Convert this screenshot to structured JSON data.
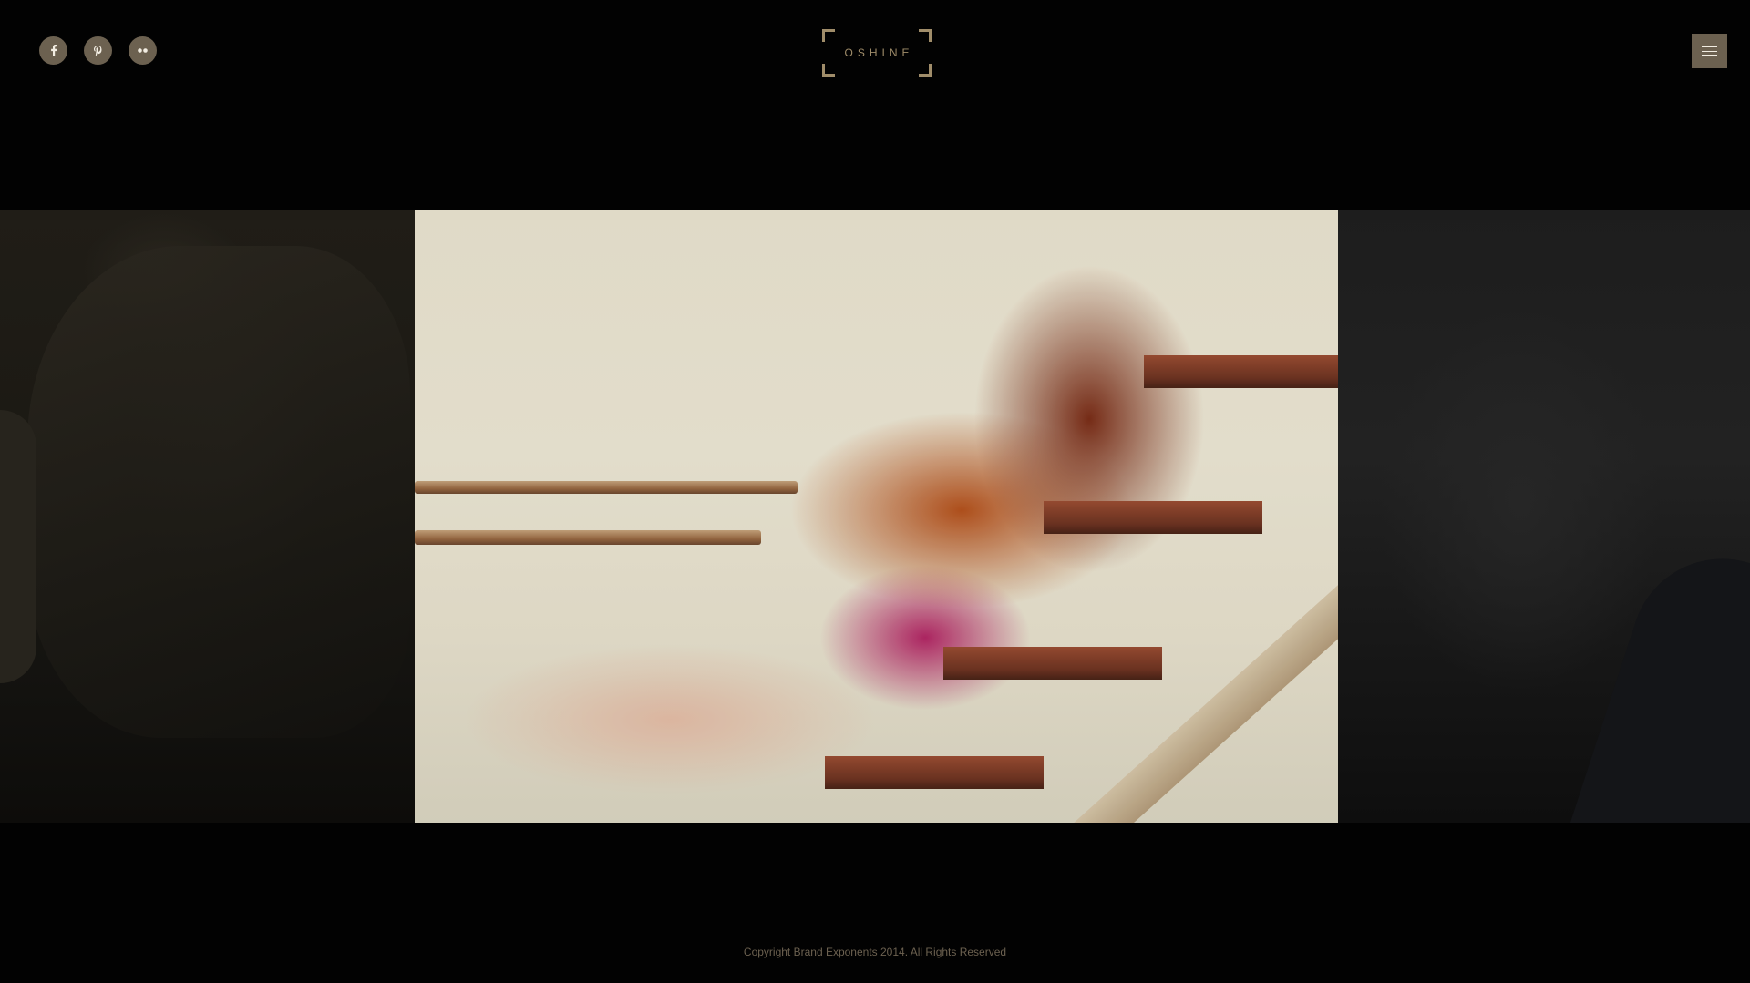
{
  "brand": {
    "logo_text": "OSHINE",
    "accent_color": "#a08d6a",
    "button_color": "#6c6150"
  },
  "header": {
    "social_links": [
      {
        "name": "facebook",
        "icon": "facebook-icon",
        "glyph": "f"
      },
      {
        "name": "pinterest",
        "icon": "pinterest-icon",
        "glyph": "p"
      },
      {
        "name": "flickr",
        "icon": "flickr-icon",
        "glyph": "••"
      }
    ],
    "menu_icon": "hamburger-icon"
  },
  "slider": {
    "slides": [
      {
        "position": "previous",
        "subject": "photo of a tree trunk and grass (dimmed)"
      },
      {
        "position": "active",
        "subject": "model in patterned clothing reclining on wooden stairs"
      },
      {
        "position": "next",
        "subject": "photo of a person against a wall (dimmed)"
      }
    ],
    "active_index": 1
  },
  "footer": {
    "copyright": "Copyright Brand Exponents 2014. All Rights Reserved"
  }
}
